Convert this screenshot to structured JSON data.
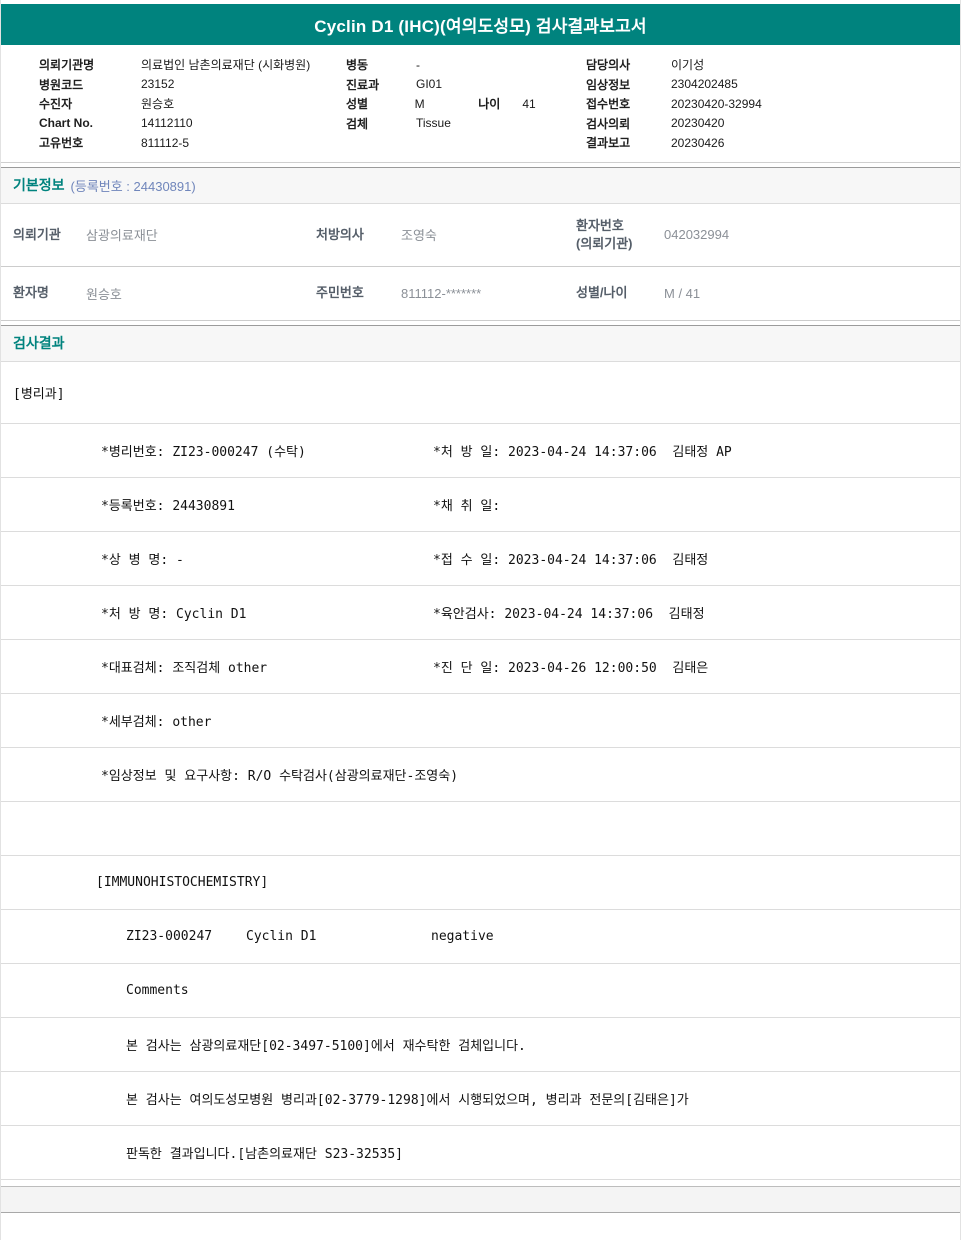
{
  "colors": {
    "accent_teal": "#00837E",
    "section_subtitle_blue": "#7086BB"
  },
  "header": {
    "title": "Cyclin D1 (IHC)(여의도성모) 검사결과보고서"
  },
  "patient_info": {
    "col1": [
      {
        "label": "의뢰기관명",
        "value": "의료법인 남촌의료재단 (시화병원)"
      },
      {
        "label": "병원코드",
        "value": "23152"
      },
      {
        "label": "수진자",
        "value": "원승호"
      },
      {
        "label": "Chart No.",
        "value": "14112110"
      },
      {
        "label": "고유번호",
        "value": "811112-5"
      }
    ],
    "col2": [
      {
        "label": "병동",
        "value": "-"
      },
      {
        "label": "진료과",
        "value": "GI01"
      },
      {
        "label": "성별",
        "value": "M",
        "age_label": "나이",
        "age_value": "41"
      },
      {
        "label": "검체",
        "value": "Tissue"
      }
    ],
    "col3": [
      {
        "label": "담당의사",
        "value": "이기성"
      },
      {
        "label": "임상정보",
        "value": "2304202485"
      },
      {
        "label": "접수번호",
        "value": "20230420-32994"
      },
      {
        "label": "검사의뢰",
        "value": "20230420"
      },
      {
        "label": "결과보고",
        "value": "20230426"
      }
    ]
  },
  "basic_info": {
    "section_title": "기본정보",
    "section_subtitle": "(등록번호 : 24430891)",
    "rows": [
      {
        "cells": [
          {
            "label": "의뢰기관",
            "value": "삼광의료재단"
          },
          {
            "label": "처방의사",
            "value": "조영숙"
          },
          {
            "label": "환자번호\n(의뢰기관)",
            "value": "042032994"
          }
        ]
      },
      {
        "cells": [
          {
            "label": "환자명",
            "value": "원승호"
          },
          {
            "label": "주민번호",
            "value": "811112-*******"
          },
          {
            "label": "성별/나이",
            "value": "M / 41"
          }
        ]
      }
    ]
  },
  "results": {
    "section_title": "검사결과",
    "department": "[병리과]",
    "detail_rows": [
      {
        "left": "*병리번호: ZI23-000247 (수탁)",
        "right": "*처 방 일: 2023-04-24 14:37:06  김태정 AP"
      },
      {
        "left": "*등록번호: 24430891",
        "right": "*채 취 일:"
      },
      {
        "left": "*상 병 명: -",
        "right": "*접 수 일: 2023-04-24 14:37:06  김태정"
      },
      {
        "left": "*처 방 명: Cyclin D1",
        "right": "*육안검사: 2023-04-24 14:37:06  김태정"
      },
      {
        "left": "*대표검체: 조직검체 other",
        "right": "*진 단 일: 2023-04-26 12:00:50  김태은"
      },
      {
        "left": "*세부검체: other",
        "right": ""
      },
      {
        "left": "*임상정보 및 요구사항: R/O 수탁검사(삼광의료재단-조영숙)",
        "right": ""
      }
    ],
    "ihc_header": "[IMMUNOHISTOCHEMISTRY]",
    "assay": {
      "specimen_no": "ZI23-000247",
      "test_name": "Cyclin D1",
      "result": "negative"
    },
    "comments_label": "Comments",
    "comments": [
      "본 검사는 삼광의료재단[02-3497-5100]에서 재수탁한 검체입니다.",
      "본 검사는 여의도성모병원 병리과[02-3779-1298]에서 시행되었으며, 병리과 전문의[김태은]가",
      "판독한 결과입니다.[남촌의료재단 S23-32535]"
    ]
  }
}
